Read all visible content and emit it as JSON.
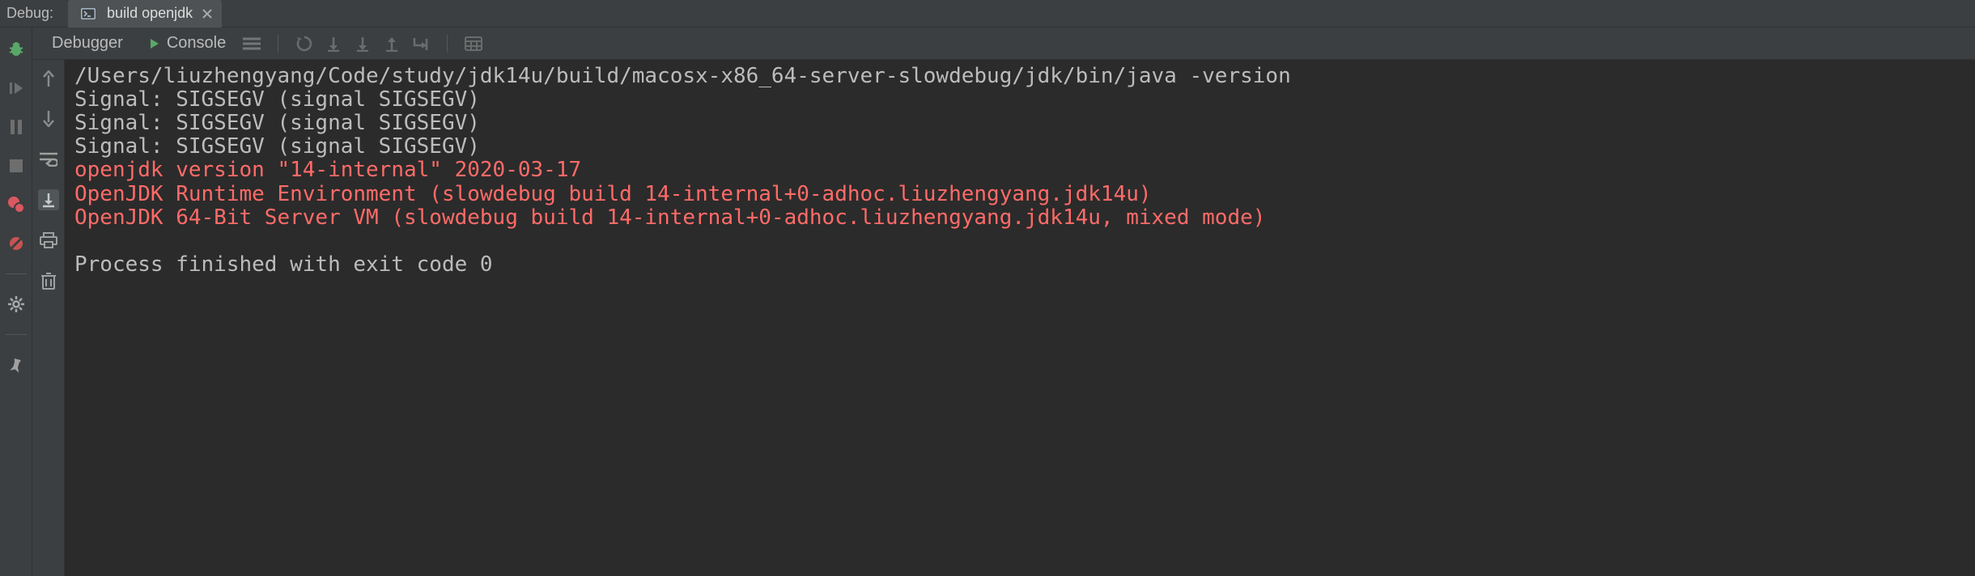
{
  "header": {
    "label": "Debug:",
    "tab": {
      "title": "build openjdk"
    }
  },
  "tabs": {
    "debugger": "Debugger",
    "console": "Console"
  },
  "console": {
    "lines": [
      {
        "text": "/Users/liuzhengyang/Code/study/jdk14u/build/macosx-x86_64-server-slowdebug/jdk/bin/java -version",
        "err": false
      },
      {
        "text": "Signal: SIGSEGV (signal SIGSEGV)",
        "err": false
      },
      {
        "text": "Signal: SIGSEGV (signal SIGSEGV)",
        "err": false
      },
      {
        "text": "Signal: SIGSEGV (signal SIGSEGV)",
        "err": false
      },
      {
        "text": "openjdk version \"14-internal\" 2020-03-17",
        "err": true
      },
      {
        "text": "OpenJDK Runtime Environment (slowdebug build 14-internal+0-adhoc.liuzhengyang.jdk14u)",
        "err": true
      },
      {
        "text": "OpenJDK 64-Bit Server VM (slowdebug build 14-internal+0-adhoc.liuzhengyang.jdk14u, mixed mode)",
        "err": true
      },
      {
        "text": "",
        "err": false
      },
      {
        "text": "Process finished with exit code 0",
        "err": false
      }
    ]
  },
  "icons": {
    "bug": "bug-icon",
    "resume": "resume-icon",
    "pause": "pause-icon",
    "stop": "stop-icon",
    "breakpoints": "breakpoints-icon",
    "mute": "mute-breakpoints-icon",
    "settings": "settings-icon",
    "pin": "pin-icon",
    "up": "up-icon",
    "down": "down-icon",
    "wrap": "soft-wrap-icon",
    "scroll": "scroll-to-end-icon",
    "print": "print-icon",
    "clear": "clear-icon",
    "restart": "restart-icon",
    "step1": "step-icon",
    "step2": "step-icon",
    "step3": "step-icon",
    "step4": "step-icon",
    "expr": "evaluate-expression-icon",
    "term": "terminal-icon",
    "close": "close-icon",
    "more": "more-icon",
    "play": "play-icon"
  }
}
